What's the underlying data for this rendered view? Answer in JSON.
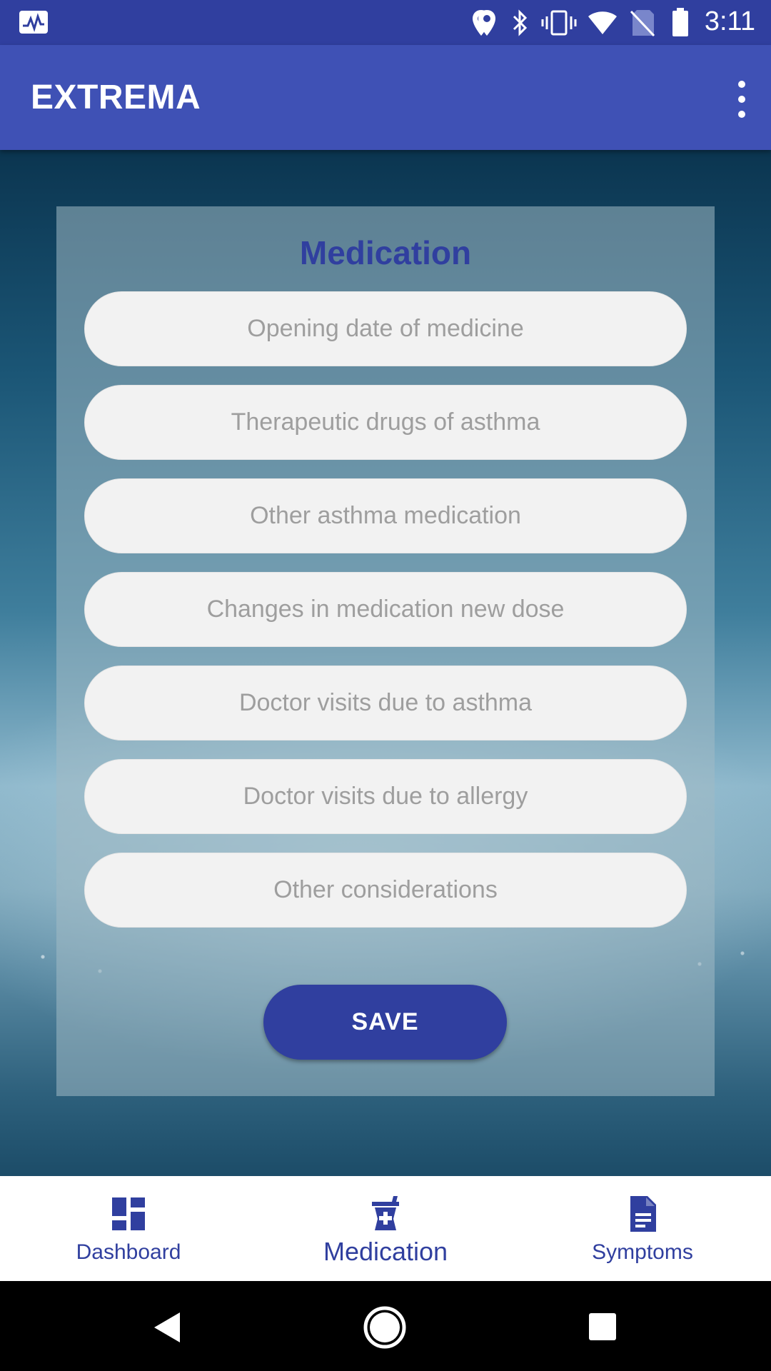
{
  "status_bar": {
    "time": "3:11",
    "left_icon": "activity-icon",
    "right_icons": [
      "location-icon",
      "bluetooth-icon",
      "vibrate-icon",
      "wifi-icon",
      "no-sim-icon",
      "battery-icon"
    ]
  },
  "app_bar": {
    "title": "EXTREMA",
    "menu_icon": "overflow-menu-icon"
  },
  "form": {
    "title": "Medication",
    "fields": [
      {
        "placeholder": "Opening date of medicine"
      },
      {
        "placeholder": "Therapeutic drugs of asthma"
      },
      {
        "placeholder": "Other asthma medication"
      },
      {
        "placeholder": "Changes in medication new dose"
      },
      {
        "placeholder": "Doctor visits due to asthma"
      },
      {
        "placeholder": "Doctor visits due to allergy"
      },
      {
        "placeholder": "Other considerations"
      }
    ],
    "save_label": "SAVE"
  },
  "bottom_nav": {
    "items": [
      {
        "label": "Dashboard",
        "icon": "dashboard-icon",
        "active": false
      },
      {
        "label": "Medication",
        "icon": "medication-icon",
        "active": true
      },
      {
        "label": "Symptoms",
        "icon": "document-icon",
        "active": false
      }
    ]
  },
  "system_nav": {
    "icons": [
      "back-icon",
      "home-icon",
      "recents-icon"
    ]
  },
  "colors": {
    "primary": "#3f51b5",
    "primary_dark": "#303f9f",
    "field_bg": "#f2f2f2",
    "placeholder_text": "#9e9e9e"
  }
}
